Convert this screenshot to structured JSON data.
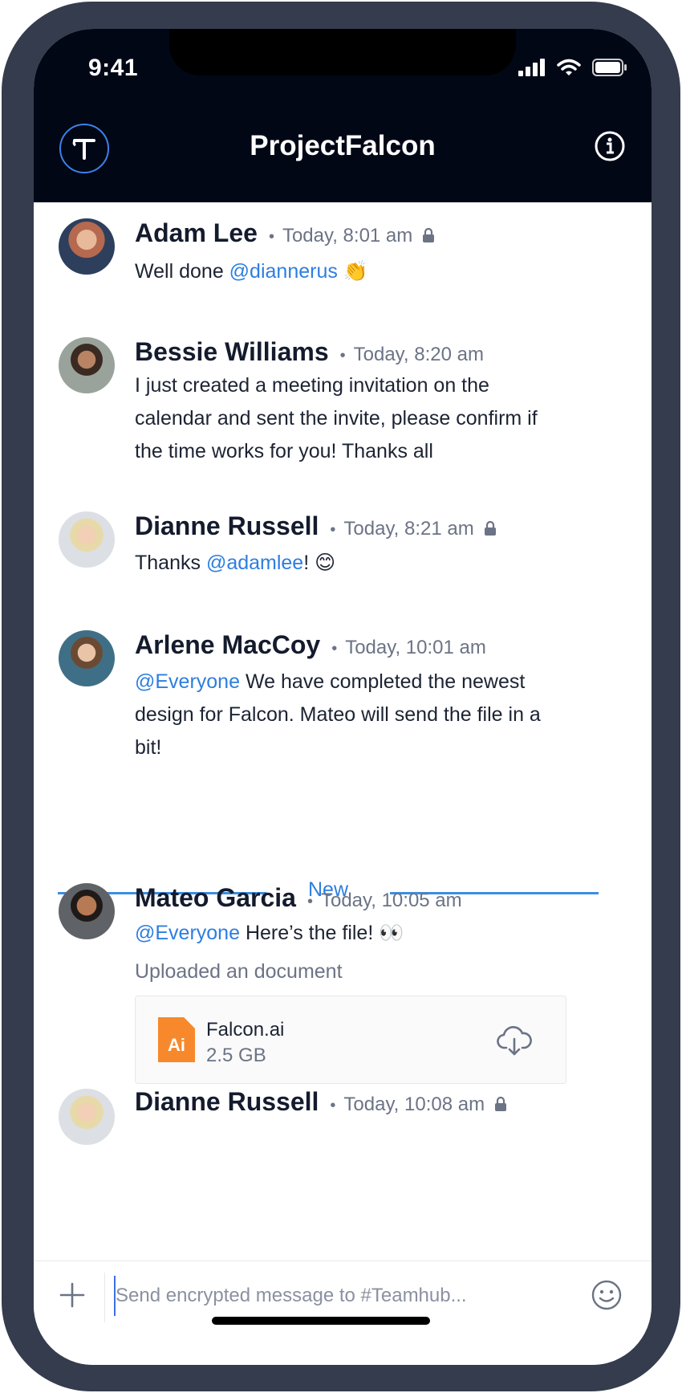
{
  "status_bar": {
    "time": "9:41"
  },
  "header": {
    "title": "ProjectFalcon",
    "logo_letter": "T"
  },
  "messages": [
    {
      "name": "Adam Lee",
      "timestamp": "Today, 8:01 am",
      "locked": true
    },
    {
      "name": "Bessie Williams",
      "timestamp": "Today, 8:20 am",
      "locked": false,
      "text": "I just created a meeting invitation on the calendar and sent the invite, please confirm if the time works for you! Thanks all"
    },
    {
      "name": "Dianne Russell",
      "timestamp": "Today, 8:21 am",
      "locked": true
    },
    {
      "name": "Arlene MacCoy",
      "timestamp": "Today, 10:01 am",
      "locked": false
    },
    {
      "name": "Mateo Garcia",
      "timestamp": "Today, 10:05 am",
      "locked": false,
      "upload_label": "Uploaded an document",
      "file": {
        "name": "Falcon.ai",
        "size": "2.5 GB",
        "type_badge": "Ai"
      }
    },
    {
      "name": "Dianne Russell",
      "timestamp": "Today, 10:08 am",
      "locked": true
    }
  ],
  "msg_parts": {
    "m0_a": "Well done ",
    "m0_mention": "@diannerus",
    "m0_emoji": "👏",
    "m2_a": "Thanks ",
    "m2_mention": "@adamlee",
    "m2_b": "! ",
    "m2_emoji": "😊",
    "m3_mention": "@Everyone",
    "m3_b": " We have completed the newest design for Falcon. Mateo will send the file in a bit!",
    "m4_mention": "@Everyone",
    "m4_b": " Here’s the file! ",
    "m4_emoji": "👀"
  },
  "divider_label": "New",
  "composer": {
    "placeholder": "Send encrypted message to #Teamhub..."
  },
  "icons": {
    "header_left": "logo-icon",
    "header_right": "info-icon",
    "lock": "lock-icon",
    "download": "cloud-download-icon",
    "add": "plus-icon",
    "emoji": "smiley-icon"
  },
  "colors": {
    "mention": "#2d7ee0",
    "header_bg": "#020716",
    "ai_badge": "#f7892c",
    "divider": "#3d8de0"
  }
}
